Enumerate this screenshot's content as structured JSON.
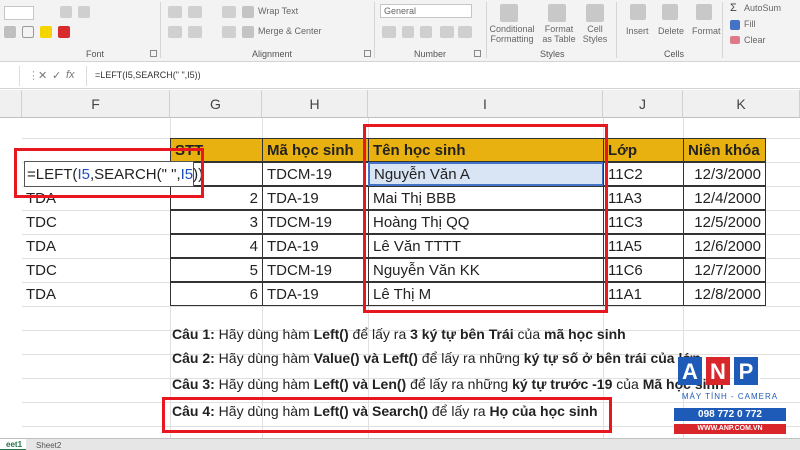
{
  "ribbon": {
    "wrap_text": "Wrap Text",
    "merge_center": "Merge & Center",
    "number_format": "General",
    "conditional_formatting": "Conditional Formatting",
    "format_as_table": "Format as Table",
    "cell_styles": "Cell Styles",
    "insert": "Insert",
    "delete": "Delete",
    "format": "Format",
    "autosum": "AutoSum",
    "fill": "Fill",
    "clear": "Clear",
    "groups": {
      "font": "Font",
      "alignment": "Alignment",
      "number": "Number",
      "styles": "Styles",
      "cells": "Cells"
    }
  },
  "formula_bar": {
    "formula": "=LEFT(I5,SEARCH(\" \",I5))",
    "cancel": "✕",
    "enter": "✓",
    "fx": "fx"
  },
  "columns": [
    "F",
    "G",
    "H",
    "I",
    "J",
    "K"
  ],
  "headers": {
    "stt": "STT",
    "ma_hoc_sinh": "Mã học sinh",
    "ten_hoc_sinh": "Tên học sinh",
    "lop": "Lớp",
    "nien_khoa": "Niên khóa"
  },
  "edit_cell": {
    "p1": "=LEFT(",
    "p2": "I5",
    "p3": ",SEARCH(\" \",",
    "p4": "I5",
    "p5": "))"
  },
  "rows": [
    {
      "f": "",
      "stt": "",
      "ma": "TDCM-19",
      "ten": "Nguyễn Văn A",
      "lop": "11C2",
      "nien": "12/3/2000"
    },
    {
      "f": "TDA",
      "stt": "2",
      "ma": "TDA-19",
      "ten": "Mai Thị BBB",
      "lop": "11A3",
      "nien": "12/4/2000"
    },
    {
      "f": "TDC",
      "stt": "3",
      "ma": "TDCM-19",
      "ten": "Hoàng Thị QQ",
      "lop": "11C3",
      "nien": "12/5/2000"
    },
    {
      "f": "TDA",
      "stt": "4",
      "ma": "TDA-19",
      "ten": "Lê Văn TTTT",
      "lop": "11A5",
      "nien": "12/6/2000"
    },
    {
      "f": "TDC",
      "stt": "5",
      "ma": "TDCM-19",
      "ten": "Nguyễn Văn KK",
      "lop": "11C6",
      "nien": "12/7/2000"
    },
    {
      "f": "TDA",
      "stt": "6",
      "ma": "TDA-19",
      "ten": "Lê Thị M",
      "lop": "11A1",
      "nien": "12/8/2000"
    }
  ],
  "questions": [
    {
      "q": "Câu 1:",
      "parts": [
        " Hãy dùng hàm ",
        "Left()",
        " để lấy ra ",
        "3 ký tự bên Trái",
        " của ",
        "mã học sinh",
        ""
      ]
    },
    {
      "q": "Câu 2:",
      "parts": [
        " Hãy dùng hàm ",
        "Value() và Left()",
        " để lấy ra những ",
        "ký tự số ở bên trái của lớp",
        "",
        "",
        ""
      ]
    },
    {
      "q": "Câu 3:",
      "parts": [
        " Hãy dùng hàm ",
        "Left() và Len()",
        " để lấy ra  những ",
        "ký tự trước -19",
        " của ",
        "Mã học sinh",
        ""
      ]
    },
    {
      "q": "Câu 4:",
      "parts": [
        " Hãy dùng hàm ",
        "Left() và Search()",
        " để lấy ra ",
        "Họ của học sinh",
        "",
        "",
        ""
      ]
    }
  ],
  "sheet_tabs": [
    "eet1",
    "Sheet2"
  ],
  "logo": {
    "brand": "ANP",
    "tagline": "MÁY TÍNH - CAMERA",
    "phone": "098 772 0 772",
    "website": "WWW.ANP.COM.VN"
  },
  "colors": {
    "header_fill": "#e9b10f",
    "highlight_red": "#e8161e",
    "formula_blue": "#1f4fbf",
    "selected_cell": "#d9e4f5",
    "logo_blue": "#1e5bb8",
    "logo_red": "#d8262a"
  }
}
